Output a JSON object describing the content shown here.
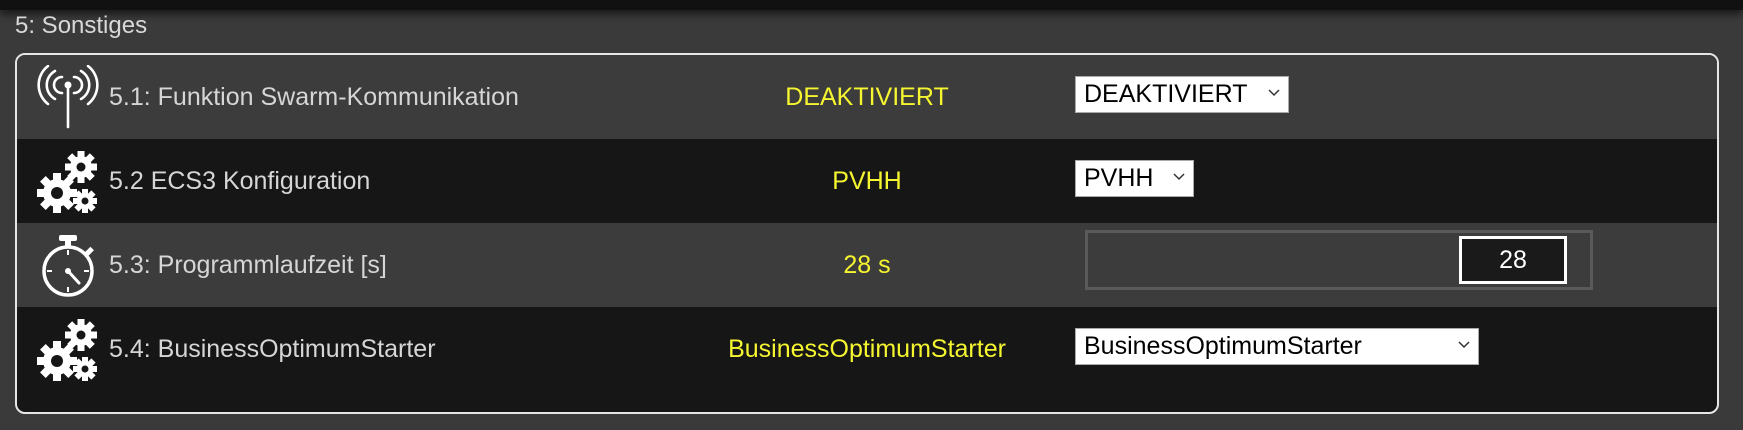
{
  "section": {
    "title": "5: Sonstiges"
  },
  "colors": {
    "value_text": "#f5f530",
    "panel_border": "#e6e6e6"
  },
  "rows": [
    {
      "label": "5.1: Funktion Swarm-Kommunikation",
      "icon": "antenna-icon",
      "value": "DEAKTIVIERT",
      "control": {
        "type": "select",
        "selected": "DEAKTIVIERT"
      }
    },
    {
      "label": "5.2 ECS3 Konfiguration",
      "icon": "gears-icon",
      "value": "PVHH",
      "control": {
        "type": "select",
        "selected": "PVHH"
      }
    },
    {
      "label": "5.3: Programmlaufzeit [s]",
      "icon": "stopwatch-icon",
      "value": "28 s",
      "control": {
        "type": "number",
        "value": "28"
      }
    },
    {
      "label": "5.4: BusinessOptimumStarter",
      "icon": "gears-icon",
      "value": "BusinessOptimumStarter",
      "control": {
        "type": "select",
        "selected": "BusinessOptimumStarter"
      }
    }
  ]
}
